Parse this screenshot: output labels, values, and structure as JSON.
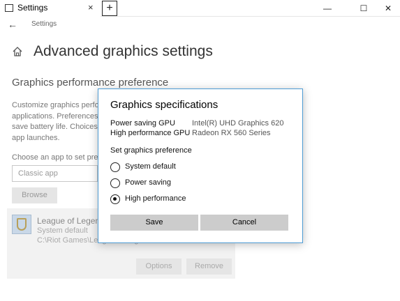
{
  "window": {
    "tab_title": "Settings",
    "tab_close": "×",
    "new_tab": "+",
    "minimize": "—",
    "maximize": "☐",
    "close": "✕"
  },
  "nav": {
    "back": "←",
    "title": "Settings"
  },
  "page": {
    "title": "Advanced graphics settings",
    "section_title": "Graphics performance preference",
    "description_lines": [
      "Customize graphics perfor",
      "applications. Preferences m",
      "save battery life. Choices m",
      "app launches."
    ],
    "choose_label": "Choose an app to set prefe",
    "app_select_value": "Classic app",
    "browse_label": "Browse"
  },
  "app_entry": {
    "name": "League of Legends",
    "preference": "System default",
    "path": "C:\\Riot Games\\League of Legends\\LeagueClient.exe",
    "options_label": "Options",
    "remove_label": "Remove"
  },
  "dialog": {
    "title": "Graphics specifications",
    "specs": [
      {
        "label": "Power saving GPU",
        "value": "Intel(R) UHD Graphics 620"
      },
      {
        "label": "High performance GPU",
        "value": "Radeon RX 560 Series"
      }
    ],
    "pref_label": "Set graphics preference",
    "options": [
      {
        "label": "System default",
        "selected": false
      },
      {
        "label": "Power saving",
        "selected": false
      },
      {
        "label": "High performance",
        "selected": true
      }
    ],
    "save_label": "Save",
    "cancel_label": "Cancel"
  },
  "colors": {
    "dialog_border": "#4d9bd4",
    "button_bg": "#cccccc"
  }
}
